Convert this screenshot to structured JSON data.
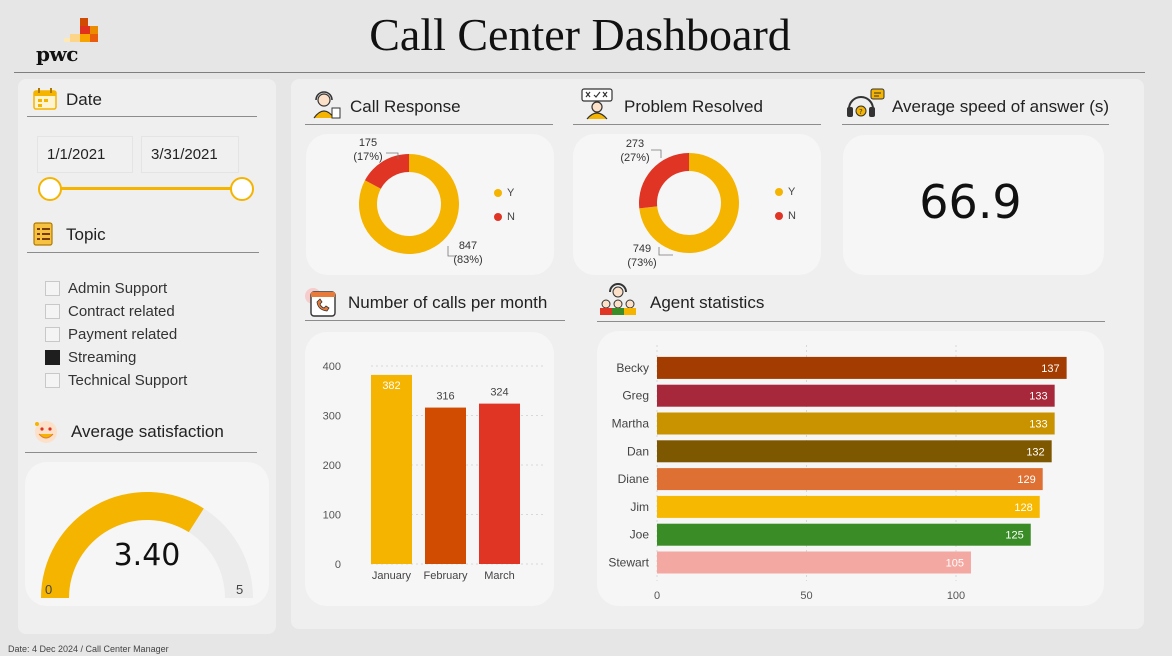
{
  "header": {
    "logo_text": "pwc",
    "title": "Call Center Dashboard"
  },
  "filters": {
    "date": {
      "label": "Date",
      "start": "1/1/2021",
      "end": "3/31/2021"
    },
    "topic": {
      "label": "Topic",
      "items": [
        {
          "label": "Admin Support",
          "checked": false
        },
        {
          "label": "Contract related",
          "checked": false
        },
        {
          "label": "Payment related",
          "checked": false
        },
        {
          "label": "Streaming",
          "checked": true
        },
        {
          "label": "Technical Support",
          "checked": false
        }
      ]
    }
  },
  "satisfaction": {
    "label": "Average satisfaction",
    "value": "3.40",
    "min": "0",
    "max": "5",
    "value_num": 3.4,
    "max_num": 5,
    "color": "#f5b400"
  },
  "call_response": {
    "label": "Call Response",
    "legend": [
      "Y",
      "N"
    ],
    "y_count": "847",
    "y_pct": "(83%)",
    "n_count": "175",
    "n_pct": "(17%)",
    "y_value": 847,
    "n_value": 175
  },
  "problem_resolved": {
    "label": "Problem Resolved",
    "legend": [
      "Y",
      "N"
    ],
    "y_count": "749",
    "y_pct": "(73%)",
    "n_count": "273",
    "n_pct": "(27%)",
    "y_value": 749,
    "n_value": 273
  },
  "speed": {
    "label": "Average speed of answer (s)",
    "value": "66.9"
  },
  "calls_per_month": {
    "label": "Number of calls per month"
  },
  "agents": {
    "label": "Agent statistics"
  },
  "colors": {
    "yes": "#f5b400",
    "no": "#e03424"
  },
  "footer": "Date: 4 Dec 2024 / Call Center Manager",
  "chart_data": [
    {
      "type": "pie",
      "title": "Call Response",
      "categories": [
        "Y",
        "N"
      ],
      "values": [
        847,
        175
      ]
    },
    {
      "type": "pie",
      "title": "Problem Resolved",
      "categories": [
        "Y",
        "N"
      ],
      "values": [
        749,
        273
      ]
    },
    {
      "type": "bar",
      "title": "Number of calls per month",
      "categories": [
        "January",
        "February",
        "March"
      ],
      "values": [
        382,
        316,
        324
      ],
      "colors": [
        "#f5b400",
        "#d14c00",
        "#e03424"
      ],
      "ylim": [
        0,
        400
      ],
      "yticks": [
        0,
        100,
        200,
        300,
        400
      ],
      "grid": true
    },
    {
      "type": "bar",
      "orientation": "horizontal",
      "title": "Agent statistics",
      "categories": [
        "Becky",
        "Greg",
        "Martha",
        "Dan",
        "Diane",
        "Jim",
        "Joe",
        "Stewart"
      ],
      "values": [
        137,
        133,
        133,
        132,
        129,
        128,
        125,
        105
      ],
      "colors": [
        "#a23c00",
        "#a7283a",
        "#c99300",
        "#7e5800",
        "#de7033",
        "#f6b800",
        "#3a8c26",
        "#f3a8a1"
      ],
      "xlim": [
        0,
        137
      ],
      "xticks": [
        0,
        50,
        100
      ],
      "grid": true
    }
  ]
}
